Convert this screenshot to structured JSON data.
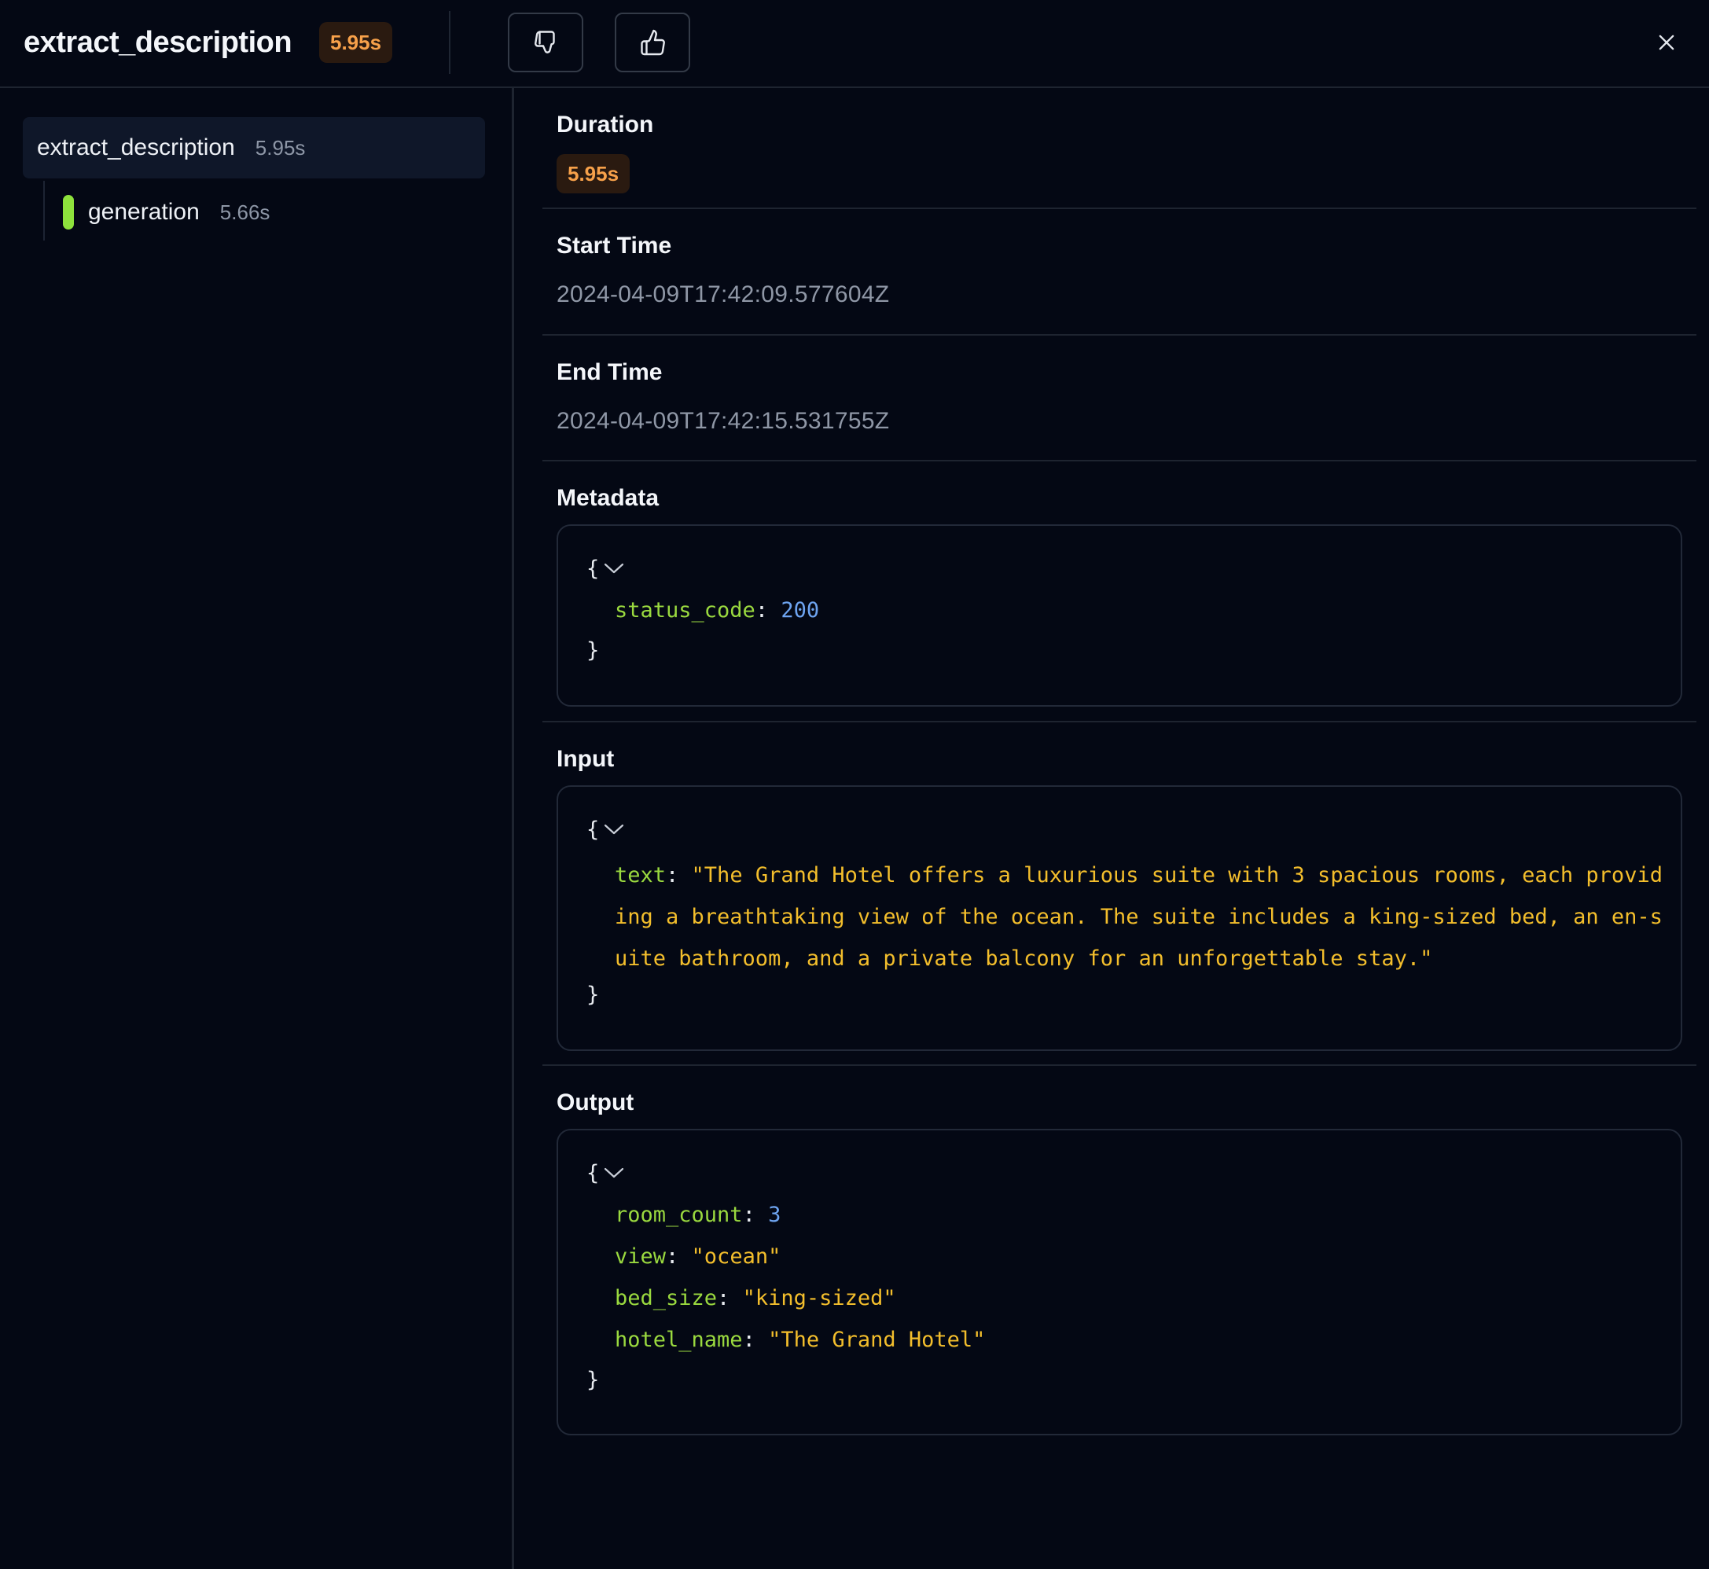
{
  "header": {
    "title": "extract_description",
    "duration_badge": "5.95s",
    "icons": [
      "thumbs-down-icon",
      "thumbs-up-icon",
      "close-icon"
    ]
  },
  "tree": {
    "root": {
      "name": "extract_description",
      "duration": "5.95s"
    },
    "children": [
      {
        "name": "generation",
        "duration": "5.66s",
        "color": "#8ee23c"
      }
    ]
  },
  "details": {
    "duration": {
      "label": "Duration",
      "value": "5.95s"
    },
    "start_time": {
      "label": "Start Time",
      "value": "2024-04-09T17:42:09.577604Z"
    },
    "end_time": {
      "label": "End Time",
      "value": "2024-04-09T17:42:15.531755Z"
    },
    "metadata": {
      "label": "Metadata",
      "open": "{",
      "close": "}",
      "status_code_key": "status_code",
      "status_code_value": "200"
    },
    "input": {
      "label": "Input",
      "open": "{",
      "close": "}",
      "text_key": "text",
      "text_value": "\"The Grand Hotel offers a luxurious suite with 3 spacious rooms, each providing a breathtaking view of the ocean. The suite includes a king-sized bed, an en-suite bathroom, and a private balcony for an unforgettable stay.\""
    },
    "output": {
      "label": "Output",
      "open": "{",
      "close": "}",
      "room_count_key": "room_count",
      "room_count_value": "3",
      "view_key": "view",
      "view_value": "\"ocean\"",
      "bed_size_key": "bed_size",
      "bed_size_value": "\"king-sized\"",
      "hotel_name_key": "hotel_name",
      "hotel_name_value": "\"The Grand Hotel\""
    },
    "colon": ": "
  },
  "colors": {
    "background": "#040814",
    "accent_orange": "#f7a14a",
    "json_key": "#9ad93f",
    "json_number": "#6ea4f0",
    "json_string": "#f3be2c",
    "generation_bar": "#8ee23c"
  }
}
